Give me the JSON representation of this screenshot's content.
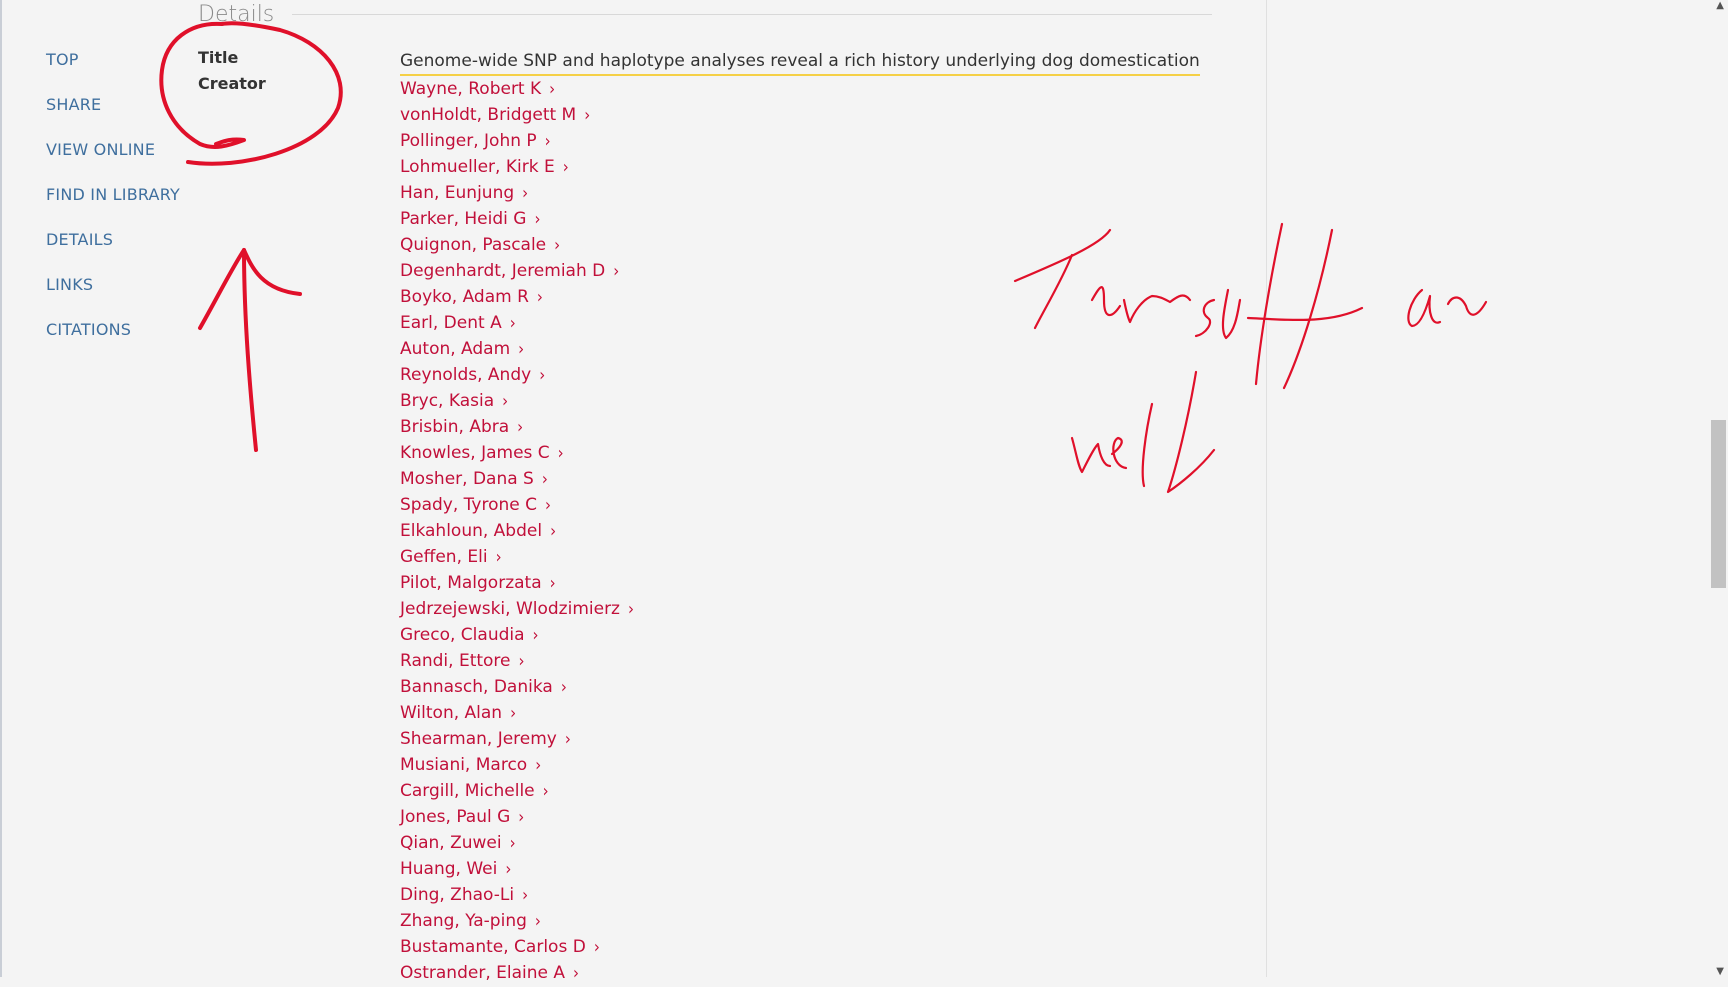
{
  "section": {
    "header": "Details"
  },
  "nav": {
    "items": [
      {
        "label": "TOP"
      },
      {
        "label": "SHARE"
      },
      {
        "label": "VIEW ONLINE"
      },
      {
        "label": "FIND IN LIBRARY"
      },
      {
        "label": "DETAILS"
      },
      {
        "label": "LINKS"
      },
      {
        "label": "CITATIONS"
      }
    ]
  },
  "fields": {
    "title_label": "Title",
    "creator_label": "Creator",
    "title_value": "Genome-wide SNP and haplotype analyses reveal a rich history underlying dog domestication"
  },
  "creators": [
    "Wayne, Robert K",
    "vonHoldt, Bridgett M",
    "Pollinger, John P",
    "Lohmueller, Kirk E",
    "Han, Eunjung",
    "Parker, Heidi G",
    "Quignon, Pascale",
    "Degenhardt, Jeremiah D",
    "Boyko, Adam R",
    "Earl, Dent A",
    "Auton, Adam",
    "Reynolds, Andy",
    "Bryc, Kasia",
    "Brisbin, Abra",
    "Knowles, James C",
    "Mosher, Dana S",
    "Spady, Tyrone C",
    "Elkahloun, Abdel",
    "Geffen, Eli",
    "Pilot, Malgorzata",
    "Jedrzejewski, Wlodzimierz",
    "Greco, Claudia",
    "Randi, Ettore",
    "Bannasch, Danika",
    "Wilton, Alan",
    "Shearman, Jeremy",
    "Musiani, Marco",
    "Cargill, Michelle",
    "Jones, Paul G",
    "Qian, Zuwei",
    "Huang, Wei",
    "Ding, Zhao-Li",
    "Zhang, Ya-ping",
    "Bustamante, Carlos D",
    "Ostrander, Elaine A"
  ],
  "icons": {
    "creator_link": "chevron-right-icon"
  },
  "colors": {
    "nav_link": "#3f6f9e",
    "creator_link": "#c1103a",
    "title_highlight": "#f5d046",
    "annotation_ink": "#e0102a"
  },
  "annotation": {
    "handwritten_note": "This stuff as well"
  }
}
